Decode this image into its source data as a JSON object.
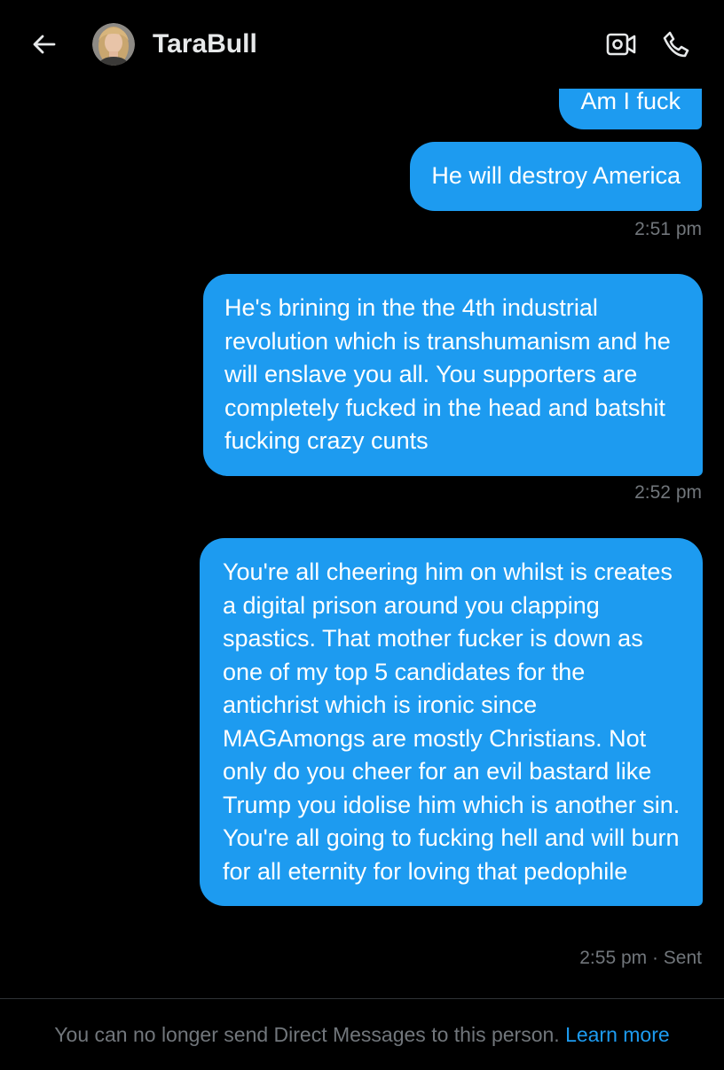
{
  "header": {
    "back_icon": "arrow-left-icon",
    "contact_name": "TaraBull",
    "avatar": "contact-avatar",
    "video_icon": "video-camera-icon",
    "call_icon": "phone-icon"
  },
  "messages": [
    {
      "text": "Am I fuck"
    },
    {
      "text": "He will destroy America",
      "timestamp": "2:51 pm"
    },
    {
      "text": "He's brining in the the 4th industrial revolution which is transhumanism and he will enslave you all. You supporters are completely fucked in the head and batshit fucking crazy cunts",
      "timestamp": "2:52 pm"
    },
    {
      "text": "You're all cheering him on whilst is creates a digital prison around you clapping spastics. That mother fucker is down as one of my top 5 candidates for the antichrist which is ironic since MAGAmongs are mostly Christians. Not only do you cheer for an evil bastard like Trump you idolise him which is another sin. You're all going to fucking hell and will burn for all eternity for loving that pedophile",
      "timestamp": "2:55 pm · Sent"
    }
  ],
  "footer": {
    "notice": "You can no longer send Direct Messages to this person.",
    "link": "Learn more"
  },
  "colors": {
    "background": "#000000",
    "bubble": "#1d9bf0",
    "muted_text": "#71767b",
    "link": "#1d9bf0"
  }
}
